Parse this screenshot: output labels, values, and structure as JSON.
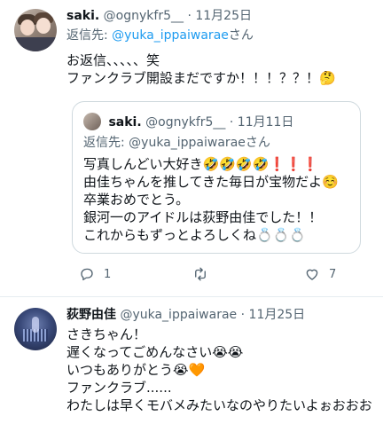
{
  "tweet1": {
    "name": "saki.",
    "handle": "@ognykfr5__",
    "dot": "·",
    "date": "11月25日",
    "reply_prefix": "返信先: ",
    "reply_handle": "@yuka_ippaiwarae",
    "reply_suffix": "さん",
    "lines": [
      "お返信、、、、、笑",
      "ファンクラブ開設まだですか！！！？？！🤔"
    ]
  },
  "quote": {
    "name": "saki.",
    "handle": "@ognykfr5__",
    "dot": "·",
    "date": "11月11日",
    "reply_prefix": "返信先: ",
    "reply_handle": "@yuka_ippaiwarae",
    "reply_suffix": "さん",
    "lines": [
      "写真しんどい大好き🤣🤣🤣🤣❗❗❗",
      "由佳ちゃんを推してきた毎日が宝物だよ☺️",
      "卒業おめでとう。",
      "銀河一のアイドルは荻野由佳でした！！",
      "これからもずっとよろしくね💍💍💍"
    ]
  },
  "actions": {
    "reply_count": "1",
    "retweet_count": "",
    "like_count": "7"
  },
  "tweet2": {
    "name": "荻野由佳",
    "handle": "@yuka_ippaiwarae",
    "dot": "·",
    "date": "11月25日",
    "lines": [
      "さきちゃん！",
      "遅くなってごめんなさい😭😭",
      "いつもありがとう😭🧡",
      "ファンクラブ......",
      "わたしは早くモバメみたいなのやりたいよぉおおお"
    ]
  }
}
